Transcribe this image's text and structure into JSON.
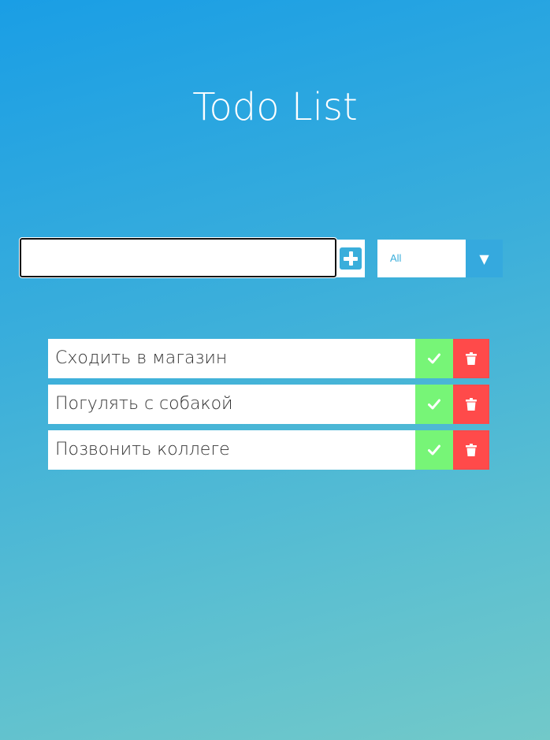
{
  "app": {
    "title": "Todo List"
  },
  "form": {
    "input_value": "",
    "input_placeholder": "",
    "add_icon": "plus-square-icon",
    "filter": {
      "selected": "All",
      "arrow_icon": "caret-down-icon"
    }
  },
  "todos": [
    {
      "text": "Сходить в магазин"
    },
    {
      "text": "Погулять с собакой"
    },
    {
      "text": "Позвонить коллеге"
    }
  ],
  "icons": {
    "complete": "check-icon",
    "delete": "trash-icon"
  },
  "colors": {
    "accent": "#3aaedb",
    "complete": "#77f577",
    "delete": "#ff4a4a",
    "background_top": "#1a9ee5",
    "background_bottom": "#72c9c9"
  }
}
